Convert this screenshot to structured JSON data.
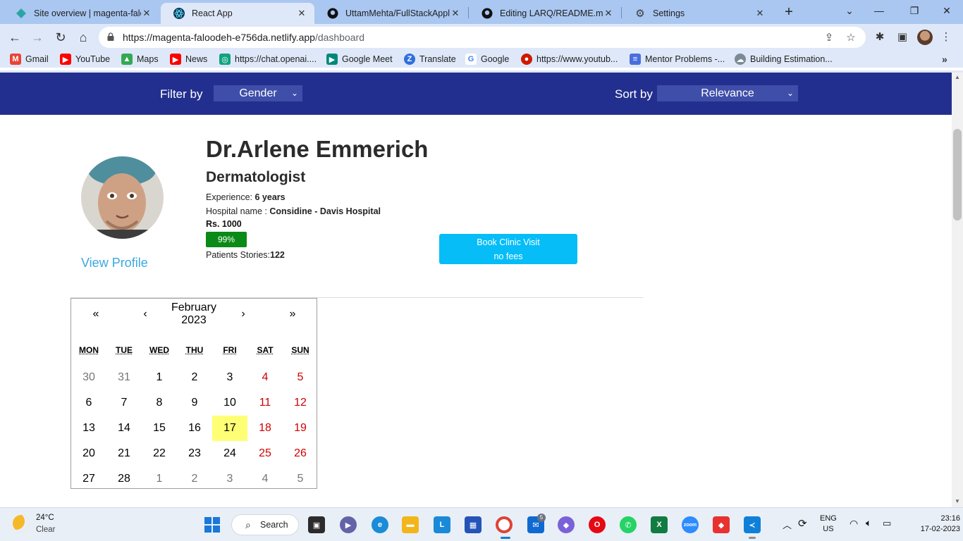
{
  "browser": {
    "tabs": [
      {
        "title": "Site overview | magenta-faloodeh",
        "icon": "netlify-icon",
        "color": "#2aa5a5",
        "active": false
      },
      {
        "title": "React App",
        "icon": "react-icon",
        "color": "#0b3a57",
        "active": true
      },
      {
        "title": "UttamMehta/FullStackApplic",
        "icon": "github-icon",
        "color": "#111111",
        "active": false
      },
      {
        "title": "Editing LARQ/README.md at",
        "icon": "github-icon",
        "color": "#111111",
        "active": false
      },
      {
        "title": "Settings",
        "icon": "gear-icon",
        "color": "#3b3b3b",
        "active": false
      }
    ],
    "address_bar": {
      "host": "https://magenta-faloodeh-e756da.netlify.app",
      "path": "/dashboard"
    },
    "bookmarks": [
      {
        "label": "Gmail",
        "icon": "gmail-icon",
        "color": "#ea4335"
      },
      {
        "label": "YouTube",
        "icon": "youtube-icon",
        "color": "#ff0000"
      },
      {
        "label": "Maps",
        "icon": "maps-icon",
        "color": "#34a853"
      },
      {
        "label": "News",
        "icon": "youtube-icon",
        "color": "#ff0000"
      },
      {
        "label": "https://chat.openai....",
        "icon": "openai-icon",
        "color": "#10a37f"
      },
      {
        "label": "Google Meet",
        "icon": "meet-icon",
        "color": "#00897b"
      },
      {
        "label": "Translate",
        "icon": "translate-icon",
        "color": "#2f6fde"
      },
      {
        "label": "Google",
        "icon": "google-icon",
        "color": "#4285f4"
      },
      {
        "label": "https://www.youtub...",
        "icon": "youtube-icon",
        "color": "#cc1a00"
      },
      {
        "label": "Mentor Problems -...",
        "icon": "docs-icon",
        "color": "#4a6ee0"
      },
      {
        "label": "Building Estimation...",
        "icon": "cloud-icon",
        "color": "#7c8a95"
      }
    ]
  },
  "filterbar": {
    "filter_label": "Filter by",
    "filter_value": "Gender",
    "sort_label": "Sort by",
    "sort_value": "Relevance",
    "bg": "#232f8e"
  },
  "doctor": {
    "name": "Dr.Arlene Emmerich",
    "specialty": "Dermatologist",
    "experience_label": "Experience: ",
    "experience_value": "6 years",
    "hospital_label": "Hospital name : ",
    "hospital_value": "Considine - Davis Hospital",
    "fee": "Rs. 1000",
    "rating": "99%",
    "stories_label": "Patients Stories:",
    "stories_value": "122",
    "view_profile": "View Profile",
    "book_line1": "Book Clinic Visit",
    "book_line2": "no fees"
  },
  "calendar": {
    "prev2": "«",
    "prev": "‹",
    "next": "›",
    "next2": "»",
    "month": "February",
    "year": "2023",
    "weekdays": [
      "MON",
      "TUE",
      "WED",
      "THU",
      "FRI",
      "SAT",
      "SUN"
    ],
    "weeks": [
      [
        "30",
        "31",
        "1",
        "2",
        "3",
        "4",
        "5"
      ],
      [
        "6",
        "7",
        "8",
        "9",
        "10",
        "11",
        "12"
      ],
      [
        "13",
        "14",
        "15",
        "16",
        "17",
        "18",
        "19"
      ],
      [
        "20",
        "21",
        "22",
        "23",
        "24",
        "25",
        "26"
      ],
      [
        "27",
        "28",
        "1",
        "2",
        "3",
        "4",
        "5"
      ]
    ],
    "today": "17"
  },
  "taskbar": {
    "weather_temp": "24°C",
    "weather_desc": "Clear",
    "search_label": "Search",
    "lang": "ENG",
    "region": "US",
    "time": "23:16",
    "date": "17-02-2023",
    "mail_badge": "5"
  }
}
